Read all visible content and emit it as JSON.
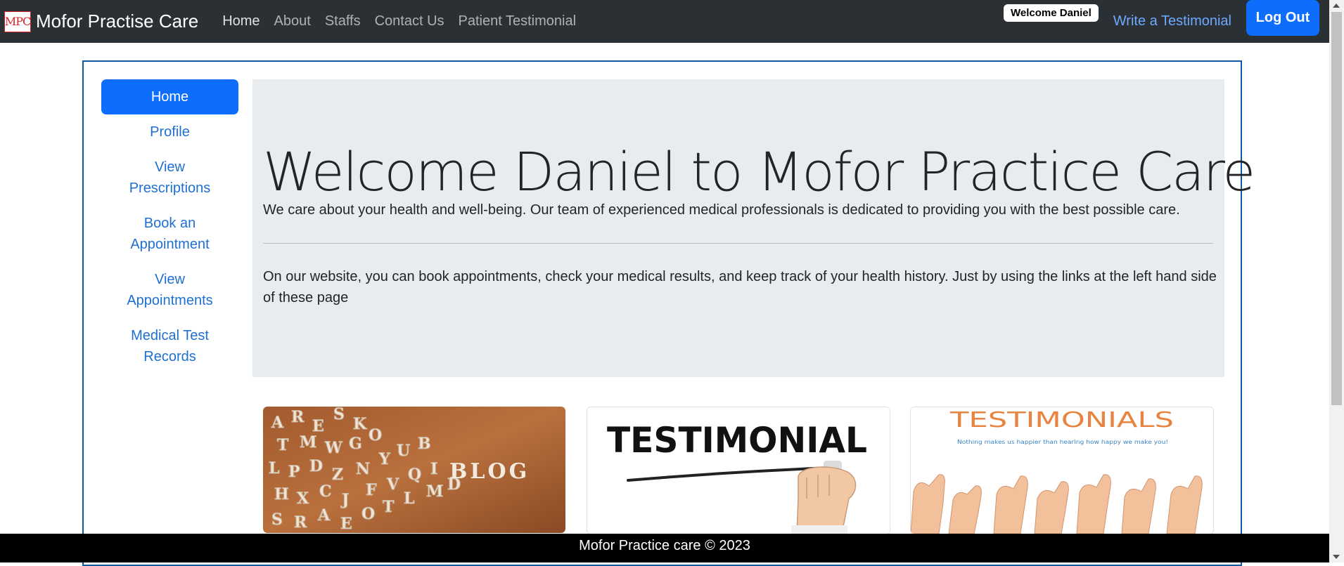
{
  "brand": {
    "logo_text": "MPC",
    "name": "Mofor Practise Care"
  },
  "nav": {
    "links": [
      "Home",
      "About",
      "Staffs",
      "Contact Us",
      "Patient Testimonial"
    ]
  },
  "user": {
    "welcome": "Welcome Daniel",
    "write_testimonial": "Write a Testimonial",
    "logout": "Log Out"
  },
  "sidebar": {
    "items": [
      {
        "label": "Home",
        "active": true
      },
      {
        "label": "Profile"
      },
      {
        "label": "View Prescriptions"
      },
      {
        "label": "Book an Appointment"
      },
      {
        "label": "View Appointments"
      },
      {
        "label": "Medical Test Records"
      }
    ]
  },
  "jumbotron": {
    "title": "Welcome Daniel to Mofor Practice Care",
    "lead": "We care about your health and well-being. Our team of experienced medical professionals is dedicated to providing you with the best possible care.",
    "body": "On our website, you can book appointments, check your medical results, and keep track of your health history. Just by using the links at the left hand side of these page"
  },
  "cards": {
    "blog": {
      "text": "BLOG"
    },
    "testimonial": {
      "text": "TESTIMONIAL"
    },
    "testimonials": {
      "text": "TESTIMONIALS",
      "tagline": "Nothing makes us happier than hearing how happy we make you!"
    }
  },
  "footer": {
    "text": "Mofor Practice care © 2023"
  },
  "colors": {
    "navbar": "#2b3035",
    "primary": "#0d6efd",
    "link": "#1f6fd1",
    "jumbotron": "#e9ecef",
    "footer": "#000000"
  }
}
